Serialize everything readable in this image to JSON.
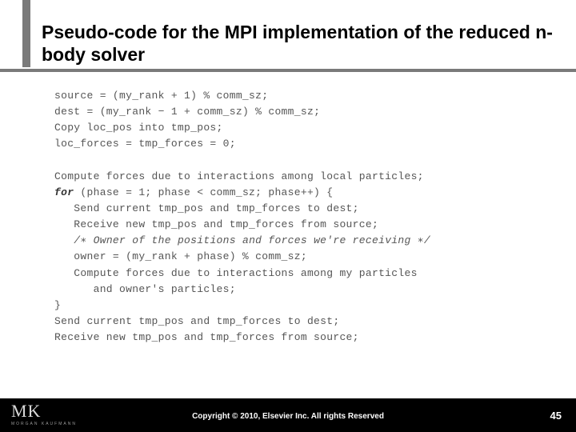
{
  "title": "Pseudo-code for the MPI implementation of the reduced n-body solver",
  "code": {
    "l1a": "source = (my_rank + 1) % comm_sz;",
    "l2a": "dest = (my_rank ",
    "l2b": "−",
    "l2c": " 1 + comm_sz) % comm_sz;",
    "l3": "Copy loc_pos into tmp_pos;",
    "l4": "loc_forces = tmp_forces = 0;",
    "blank1": "",
    "l5": "Compute forces due to interactions among local particles;",
    "l6a": "for",
    "l6b": " (phase = 1; phase < comm_sz; phase++) {",
    "l7": "   Send current tmp_pos and tmp_forces to dest;",
    "l8": "   Receive new tmp_pos and tmp_forces from source;",
    "l9": "   /∗ Owner of the positions and forces we're receiving ∗/",
    "l10": "   owner = (my_rank + phase) % comm_sz;",
    "l11": "   Compute forces due to interactions among my particles",
    "l12": "      and owner's particles;",
    "l13": "}",
    "l14": "Send current tmp_pos and tmp_forces to dest;",
    "l15": "Receive new tmp_pos and tmp_forces from source;"
  },
  "logo": {
    "main": "MK",
    "sub": "MORGAN KAUFMANN"
  },
  "copyright": "Copyright © 2010, Elsevier Inc. All rights Reserved",
  "page": "45"
}
